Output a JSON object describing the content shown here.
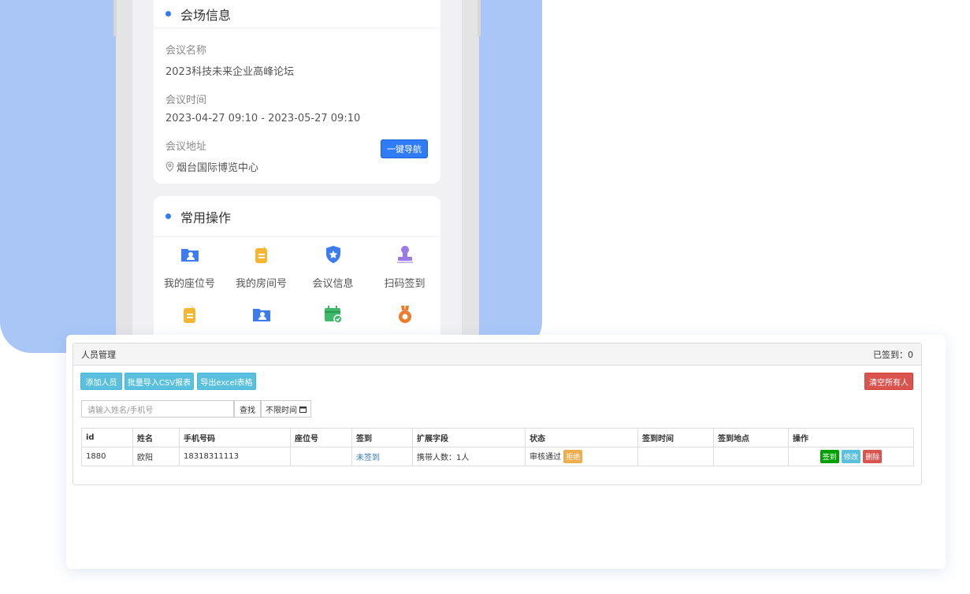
{
  "venue": {
    "title": "会场信息",
    "name_label": "会议名称",
    "name_value": "2023科技未来企业高峰论坛",
    "time_label": "会议时间",
    "time_value": "2023-04-27 09:10 - 2023-05-27 09:10",
    "address_label": "会议地址",
    "address_value": "烟台国际博览中心",
    "nav_button": "一键导航"
  },
  "ops": {
    "title": "常用操作",
    "items": [
      {
        "label": "我的座位号",
        "icon": "seat-folder-icon"
      },
      {
        "label": "我的房间号",
        "icon": "room-tag-icon"
      },
      {
        "label": "会议信息",
        "icon": "shield-star-icon"
      },
      {
        "label": "扫码签到",
        "icon": "stamp-icon"
      },
      {
        "label": "",
        "icon": "clipboard-icon"
      },
      {
        "label": "",
        "icon": "user-folder-icon"
      },
      {
        "label": "",
        "icon": "calendar-check-icon"
      },
      {
        "label": "",
        "icon": "medal-icon"
      }
    ]
  },
  "admin": {
    "title": "人员管理",
    "signed_count": "已签到：0",
    "add_button": "添加人员",
    "import_button": "批量导入CSV报表",
    "export_button": "导出excel表格",
    "clear_button": "清空所有人",
    "search_placeholder": "请输入姓名/手机号",
    "search_button": "查找",
    "time_filter": "不限时间",
    "columns": [
      "id",
      "姓名",
      "手机号码",
      "座位号",
      "签到",
      "扩展字段",
      "状态",
      "签到时间",
      "签到地点",
      "操作"
    ],
    "rows": [
      {
        "id": "1880",
        "name": "欧阳",
        "phone": "18318311113",
        "seat": "",
        "signin": "未签到",
        "ext": "携带人数：1人",
        "status": "审核通过",
        "status_badge": "拒绝",
        "signin_time": "",
        "signin_place": "",
        "actions": [
          "签到",
          "修改",
          "删除"
        ]
      }
    ]
  },
  "colors": {
    "blue_bg": "#a9c6f7",
    "primary": "#2f7cf6",
    "info": "#5bc0de",
    "danger": "#d9534f",
    "success": "#00a000"
  }
}
